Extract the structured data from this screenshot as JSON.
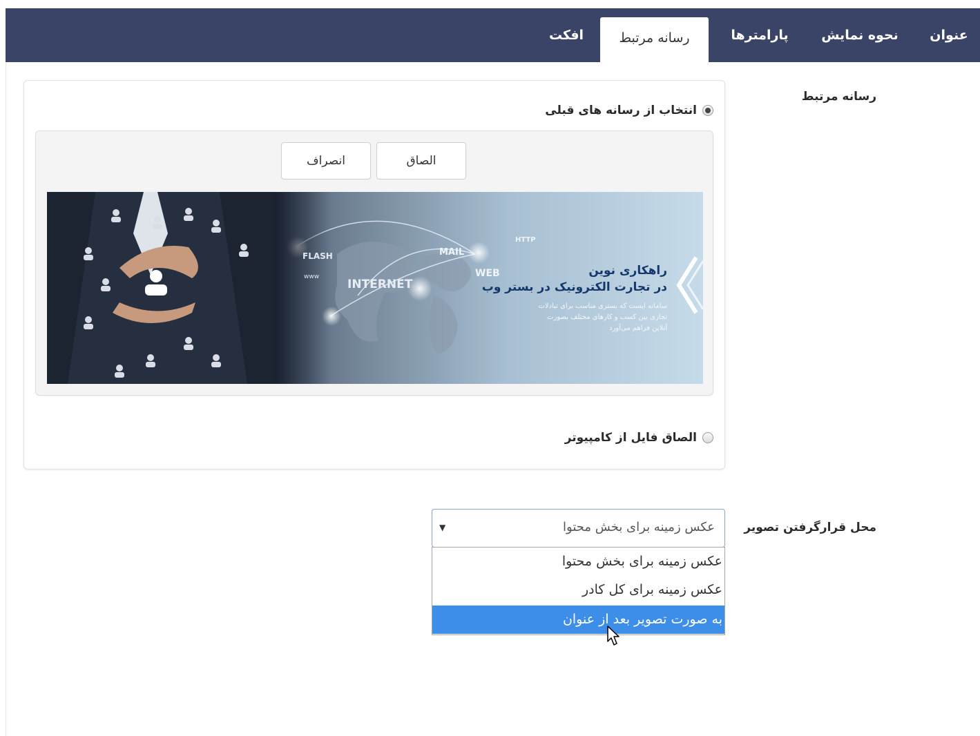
{
  "tabs": [
    {
      "label": "عنوان",
      "active": false
    },
    {
      "label": "نحوه نمایش",
      "active": false
    },
    {
      "label": "پارامترها",
      "active": false
    },
    {
      "label": "رسانه مرتبط",
      "active": true
    },
    {
      "label": "افکت",
      "active": false
    }
  ],
  "media": {
    "label": "رسانه مرتبط",
    "option_existing": "انتخاب از رسانه های قبلی",
    "option_upload": "الصاق فایل از کامپیوتر",
    "selected_option": "existing",
    "attach_button": "الصاق",
    "cancel_button": "انصراف",
    "banner": {
      "headline_1": "راهکاری نوین",
      "headline_2": "در تجارت الکترونیک در بستر وب",
      "body_line_1": "سامانه ایست که بستری مناسب برای تبادلات",
      "body_line_2": "تجاری بین کسب و کارهای مختلف بصورت",
      "body_line_3": "آنلاین فراهم می‌آورد",
      "word_flash": "FLASH",
      "word_www": "www",
      "word_internet": "INTERNET",
      "word_mail": "MAIL",
      "word_web": "WEB",
      "word_http": "HTTP"
    }
  },
  "image_position": {
    "label": "محل قرارگرفتن تصویر",
    "current_value": "عکس زمینه برای بخش محتوا",
    "options": [
      "عکس زمینه برای بخش محتوا",
      "عکس زمینه برای کل کادر",
      "به صورت تصویر بعد از عنوان"
    ],
    "highlighted_option": "به صورت تصویر بعد از عنوان"
  },
  "colors": {
    "tabbar": "#3a4466",
    "highlight": "#3d8ee9",
    "select_border": "#8ea6c9"
  }
}
